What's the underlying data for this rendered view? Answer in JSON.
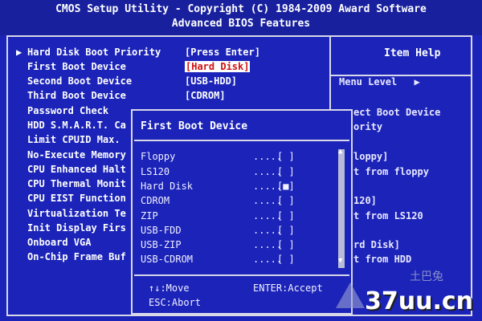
{
  "header": {
    "line1": "CMOS Setup Utility - Copyright (C) 1984-2009 Award Software",
    "line2": "Advanced BIOS Features"
  },
  "settings": [
    {
      "label": "Hard Disk Boot Priority",
      "value": "[Press Enter]",
      "arrow": "▶"
    },
    {
      "label": "First Boot Device",
      "value": "[Hard Disk]",
      "highlight": true
    },
    {
      "label": "Second Boot Device",
      "value": "[USB-HDD]"
    },
    {
      "label": "Third Boot Device",
      "value": "[CDROM]"
    },
    {
      "label": "Password Check"
    },
    {
      "label": "HDD S.M.A.R.T. Ca"
    },
    {
      "label": "Limit CPUID Max."
    },
    {
      "label": "No-Execute Memory"
    },
    {
      "label": "CPU Enhanced Halt"
    },
    {
      "label": "CPU Thermal Monit"
    },
    {
      "label": "CPU EIST Function"
    },
    {
      "label": "Virtualization Te"
    },
    {
      "label": "Init Display Firs"
    },
    {
      "label": "Onboard VGA"
    },
    {
      "label": "On-Chip Frame Buf"
    }
  ],
  "help": {
    "title": "Item Help",
    "menu_level": "Menu Level",
    "menu_level_arrow": "▶",
    "lines": [
      "ect Boot Device",
      "ority",
      "loppy]",
      "t from floppy",
      "120]",
      "t from LS120",
      "rd Disk]",
      "t from HDD"
    ]
  },
  "popup": {
    "title": "First Boot Device",
    "options": [
      {
        "name": "Floppy",
        "dots": ".....",
        "mark": "[ ]"
      },
      {
        "name": "LS120",
        "dots": ".....",
        "mark": "[ ]"
      },
      {
        "name": "Hard Disk",
        "dots": ".....",
        "mark": "[■]"
      },
      {
        "name": "CDROM",
        "dots": ".....",
        "mark": "[ ]"
      },
      {
        "name": "ZIP",
        "dots": ".....",
        "mark": "[ ]"
      },
      {
        "name": "USB-FDD",
        "dots": ".....",
        "mark": "[ ]"
      },
      {
        "name": "USB-ZIP",
        "dots": ".....",
        "mark": "[ ]"
      },
      {
        "name": "USB-CDROM",
        "dots": ".....",
        "mark": "[ ]"
      }
    ],
    "keys_move": "↑↓:Move",
    "keys_enter": "ENTER:Accept",
    "keys_abort": "ESC:Abort",
    "scroll_up": "▲",
    "scroll_down": "▼"
  },
  "watermark": {
    "text": "37uu.cn",
    "small": "土巴兔"
  },
  "colors": {
    "background": "#1b23b8",
    "highlight_bg": "#ffffff",
    "highlight_fg": "#d01010"
  }
}
